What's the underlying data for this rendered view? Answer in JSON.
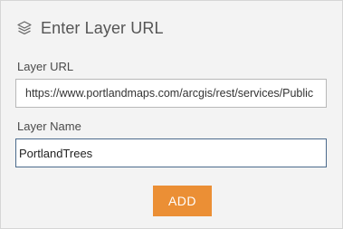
{
  "dialog": {
    "title": "Enter Layer URL",
    "header_icon": "layers-icon"
  },
  "layer_url": {
    "label": "Layer URL",
    "value": "https://www.portlandmaps.com/arcgis/rest/services/Public"
  },
  "layer_name": {
    "label": "Layer Name",
    "value": "PortlandTrees"
  },
  "actions": {
    "add_label": "ADD",
    "add_color": "#eb8f35"
  }
}
